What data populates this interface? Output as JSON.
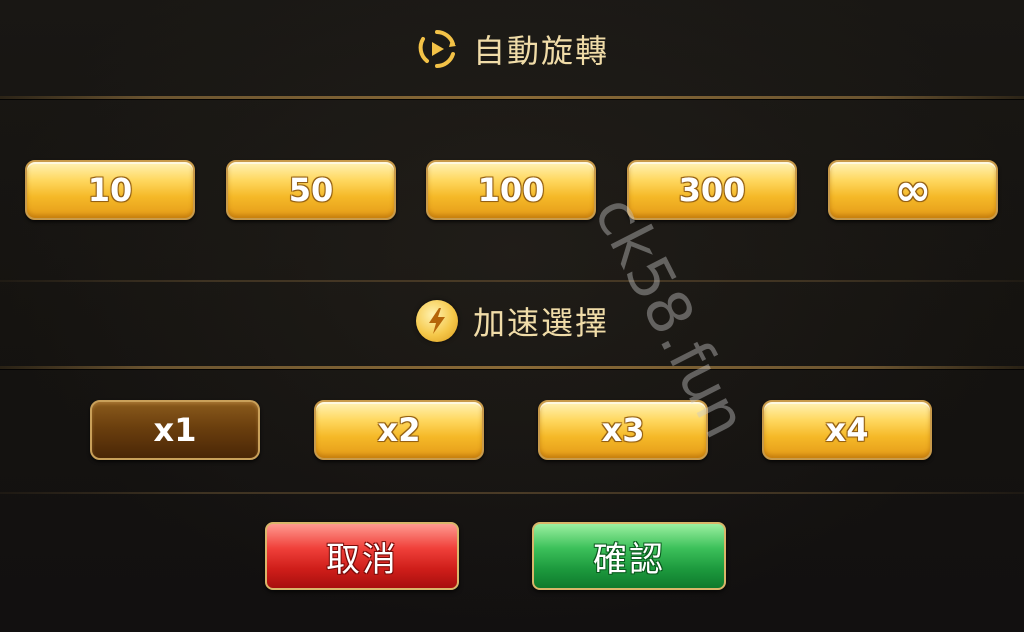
{
  "auto_spin": {
    "title": "自動旋轉",
    "icon": "autoplay-icon",
    "options": [
      "10",
      "50",
      "100",
      "300",
      "∞"
    ]
  },
  "speed": {
    "title": "加速選擇",
    "icon": "lightning-icon",
    "options": [
      "x1",
      "x2",
      "x3",
      "x4"
    ],
    "selected": "x1"
  },
  "actions": {
    "cancel_label": "取消",
    "confirm_label": "確認"
  },
  "watermark": "ck58.fun",
  "colors": {
    "title_text": "#f0dca8",
    "gold_button": "#f5b928",
    "selected_button": "#6b3f0e",
    "cancel": "#cf1e1a",
    "confirm": "#1d9a3e"
  }
}
